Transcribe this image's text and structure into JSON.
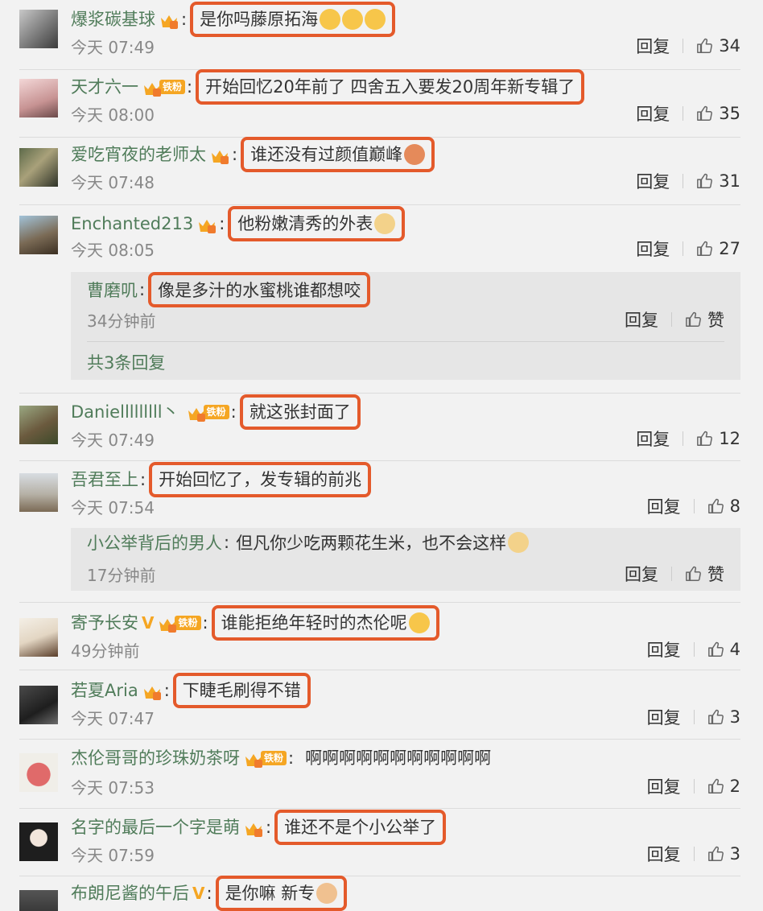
{
  "comments": [
    {
      "user": "爆浆碳基球",
      "text": "是你吗藤原拓海",
      "emojis": 3,
      "fan": false,
      "vip": false,
      "time": "今天 07:49",
      "reply": "回复",
      "likes": "34",
      "boxed": true
    },
    {
      "user": "天才六一",
      "text": "开始回忆20年前了 四舍五入要发20周年新专辑了",
      "emojis": 0,
      "fan": true,
      "fan_label": "铁粉",
      "vip": false,
      "time": "今天 08:00",
      "reply": "回复",
      "likes": "35",
      "boxed": true
    },
    {
      "user": "爱吃宵夜的老师太",
      "text": "谁还没有过颜值巅峰",
      "emojis": 1,
      "fan": false,
      "vip": false,
      "time": "今天 07:48",
      "reply": "回复",
      "likes": "31",
      "boxed": true
    },
    {
      "user": "Enchanted213",
      "text": "他粉嫩清秀的外表",
      "emojis": 1,
      "fan": false,
      "vip": false,
      "time": "今天 08:05",
      "reply": "回复",
      "likes": "27",
      "boxed": true,
      "subs": [
        {
          "user": "曹磨叽",
          "text": "像是多汁的水蜜桃谁都想咬",
          "boxed": true,
          "time": "34分钟前",
          "reply": "回复",
          "like": "赞"
        }
      ],
      "sub_more": "共3条回复"
    },
    {
      "user": "Danielllllllll丶",
      "text": "就这张封面了",
      "emojis": 0,
      "fan": true,
      "fan_label": "铁粉",
      "vip": false,
      "time": "今天 07:49",
      "reply": "回复",
      "likes": "12",
      "boxed": true
    },
    {
      "user": "吾君至上",
      "text": "开始回忆了，发专辑的前兆",
      "emojis": 0,
      "fan": false,
      "vip": false,
      "time": "今天 07:54",
      "reply": "回复",
      "likes": "8",
      "boxed": true,
      "subs": [
        {
          "user": "小公举背后的男人",
          "text": "但凡你少吃两颗花生米，也不会这样",
          "emoji": true,
          "boxed": false,
          "time": "17分钟前",
          "reply": "回复",
          "like": "赞"
        }
      ]
    },
    {
      "user": "寄予长安",
      "text": "谁能拒绝年轻时的杰伦呢",
      "emojis": 1,
      "fan": true,
      "fan_label": "铁粉",
      "vip": true,
      "time": "49分钟前",
      "reply": "回复",
      "likes": "4",
      "boxed": true
    },
    {
      "user": "若夏Aria",
      "text": "下睫毛刷得不错",
      "emojis": 0,
      "fan": false,
      "vip": false,
      "time": "今天 07:47",
      "reply": "回复",
      "likes": "3",
      "boxed": true
    },
    {
      "user": "杰伦哥哥的珍珠奶茶呀",
      "text": "啊啊啊啊啊啊啊啊啊啊啊",
      "emojis": 0,
      "fan": true,
      "fan_label": "铁粉",
      "vip": false,
      "time": "今天 07:53",
      "reply": "回复",
      "likes": "2",
      "boxed": false
    },
    {
      "user": "名字的最后一个字是萌",
      "text": "谁还不是个小公举了",
      "emojis": 0,
      "fan": false,
      "vip": false,
      "time": "今天 07:59",
      "reply": "回复",
      "likes": "3",
      "boxed": true
    },
    {
      "user": "布朗尼酱的午后",
      "text": "是你嘛 新专",
      "emojis": 1,
      "fan": false,
      "vip": true,
      "time": "",
      "reply": "",
      "likes": "",
      "boxed": true
    }
  ],
  "colors": {
    "accent": "#e45a2b",
    "username": "#507c5a",
    "badge": "#f5a623"
  }
}
